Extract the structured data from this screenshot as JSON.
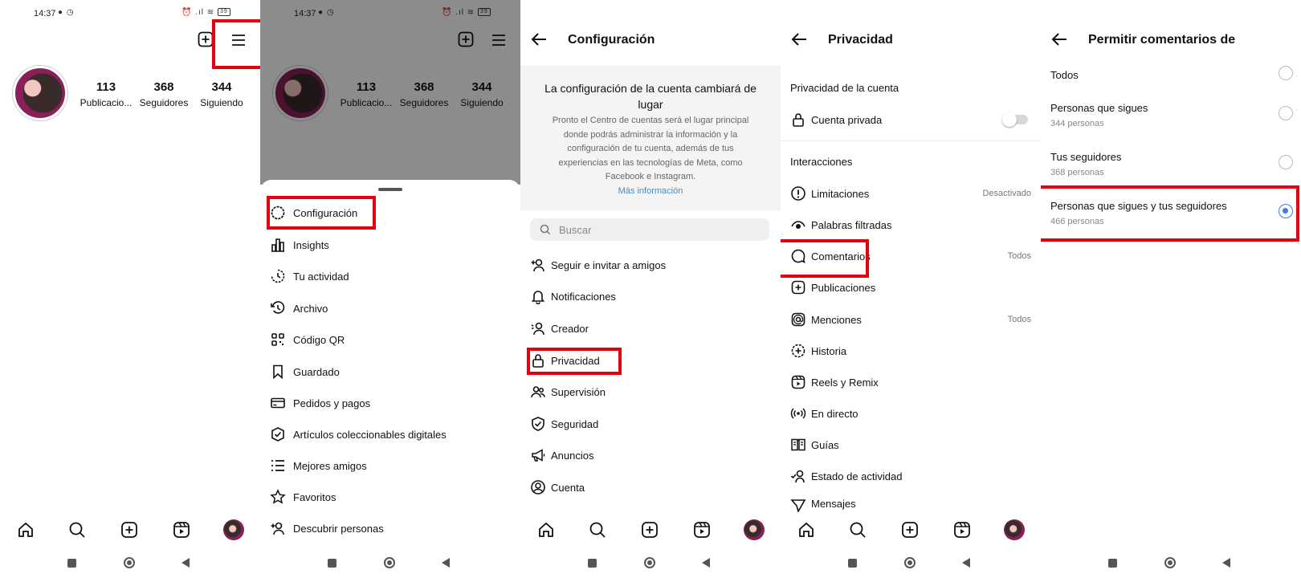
{
  "panel1": {
    "status_time": "14:37",
    "status_icons": "● ◷",
    "status_right": "⏰ .ıl ≋",
    "battery": "39",
    "stats": [
      {
        "num": "113",
        "label": "Publicacio..."
      },
      {
        "num": "368",
        "label": "Seguidores"
      },
      {
        "num": "344",
        "label": "Siguiendo"
      }
    ]
  },
  "panel2": {
    "status_time": "14:37",
    "status_icons": "● ◷",
    "status_right": "⏰ .ıl ≋",
    "battery": "39",
    "stats": [
      {
        "num": "113",
        "label": "Publicacio..."
      },
      {
        "num": "368",
        "label": "Seguidores"
      },
      {
        "num": "344",
        "label": "Siguiendo"
      }
    ],
    "menu": [
      {
        "label": "Configuración",
        "icon": "settings-icon"
      },
      {
        "label": "Insights",
        "icon": "insights-icon"
      },
      {
        "label": "Tu actividad",
        "icon": "activity-icon"
      },
      {
        "label": "Archivo",
        "icon": "archive-icon"
      },
      {
        "label": "Código QR",
        "icon": "qr-icon"
      },
      {
        "label": "Guardado",
        "icon": "bookmark-icon"
      },
      {
        "label": "Pedidos y pagos",
        "icon": "card-icon"
      },
      {
        "label": "Artículos coleccionables digitales",
        "icon": "badge-icon"
      },
      {
        "label": "Mejores amigos",
        "icon": "list-icon"
      },
      {
        "label": "Favoritos",
        "icon": "star-icon"
      },
      {
        "label": "Descubrir personas",
        "icon": "add-person-icon"
      }
    ]
  },
  "panel3": {
    "title": "Configuración",
    "notice_title": "La configuración de la cuenta cambiará de lugar",
    "notice_body": "Pronto el Centro de cuentas será el lugar principal donde podrás administrar la información y la configuración de tu cuenta, además de tus experiencias en las tecnologías de Meta, como Facebook e Instagram.",
    "notice_link": "Más información",
    "search_placeholder": "Buscar",
    "items": [
      {
        "label": "Seguir e invitar a amigos",
        "icon": "add-person-icon"
      },
      {
        "label": "Notificaciones",
        "icon": "bell-icon"
      },
      {
        "label": "Creador",
        "icon": "creator-icon"
      },
      {
        "label": "Privacidad",
        "icon": "lock-icon"
      },
      {
        "label": "Supervisión",
        "icon": "supervision-icon"
      },
      {
        "label": "Seguridad",
        "icon": "shield-icon"
      },
      {
        "label": "Anuncios",
        "icon": "megaphone-icon"
      },
      {
        "label": "Cuenta",
        "icon": "account-icon"
      }
    ]
  },
  "panel4": {
    "title": "Privacidad",
    "section_account": "Privacidad de la cuenta",
    "private_label": "Cuenta privada",
    "section_interactions": "Interacciones",
    "items": [
      {
        "label": "Limitaciones",
        "value": "Desactivado",
        "icon": "limit-icon"
      },
      {
        "label": "Palabras filtradas",
        "value": "",
        "icon": "eye-icon"
      },
      {
        "label": "Comentarios",
        "value": "Todos",
        "icon": "comment-icon"
      },
      {
        "label": "Publicaciones",
        "value": "",
        "icon": "plus-square-icon"
      },
      {
        "label": "Menciones",
        "value": "Todos",
        "icon": "at-icon"
      },
      {
        "label": "Historia",
        "value": "",
        "icon": "story-icon"
      },
      {
        "label": "Reels y Remix",
        "value": "",
        "icon": "reels-icon"
      },
      {
        "label": "En directo",
        "value": "",
        "icon": "live-icon"
      },
      {
        "label": "Guías",
        "value": "",
        "icon": "guide-icon"
      },
      {
        "label": "Estado de actividad",
        "value": "",
        "icon": "activity-status-icon"
      },
      {
        "label": "Mensajes",
        "value": "",
        "icon": "send-icon"
      }
    ]
  },
  "panel5": {
    "title": "Permitir comentarios de",
    "options": [
      {
        "title": "Todos",
        "sub": "",
        "selected": false
      },
      {
        "title": "Personas que sigues",
        "sub": "344 personas",
        "selected": false
      },
      {
        "title": "Tus seguidores",
        "sub": "368 personas",
        "selected": false
      },
      {
        "title": "Personas que sigues y tus seguidores",
        "sub": "466 personas",
        "selected": true
      }
    ]
  },
  "colors": {
    "highlight": "#e3000f",
    "accent": "#3a7bf4",
    "link": "#3a8fd6"
  }
}
